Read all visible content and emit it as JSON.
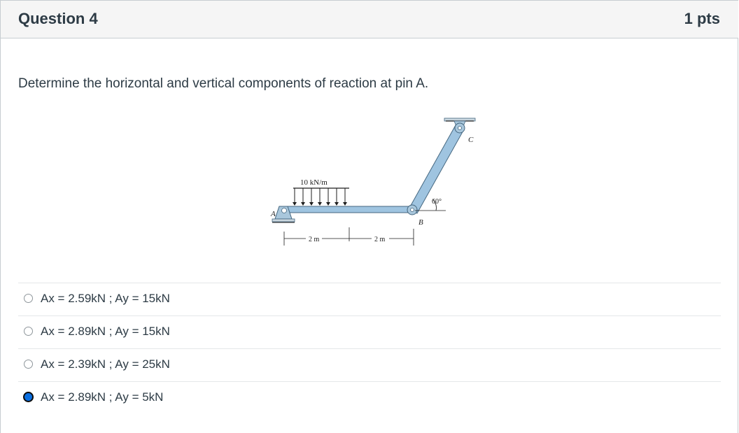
{
  "header": {
    "title": "Question 4",
    "points": "1 pts"
  },
  "prompt": "Determine the horizontal and vertical components of reaction at pin A.",
  "figure": {
    "load_label": "10 kN/m",
    "label_A": "A",
    "label_B": "B",
    "label_C": "C",
    "angle_label": "60°",
    "dim_left": "2 m",
    "dim_right": "2 m",
    "colors": {
      "member": "#9fc4e0",
      "member_edge": "#44667f",
      "support": "#a9c7dc",
      "line": "#1d1d1d"
    }
  },
  "answers": [
    {
      "label": "Ax = 2.59kN ; Ay = 15kN",
      "selected": false
    },
    {
      "label": "Ax = 2.89kN ; Ay = 15kN",
      "selected": false
    },
    {
      "label": "Ax = 2.39kN ; Ay = 25kN",
      "selected": false
    },
    {
      "label": "Ax = 2.89kN ; Ay = 5kN",
      "selected": true
    }
  ]
}
